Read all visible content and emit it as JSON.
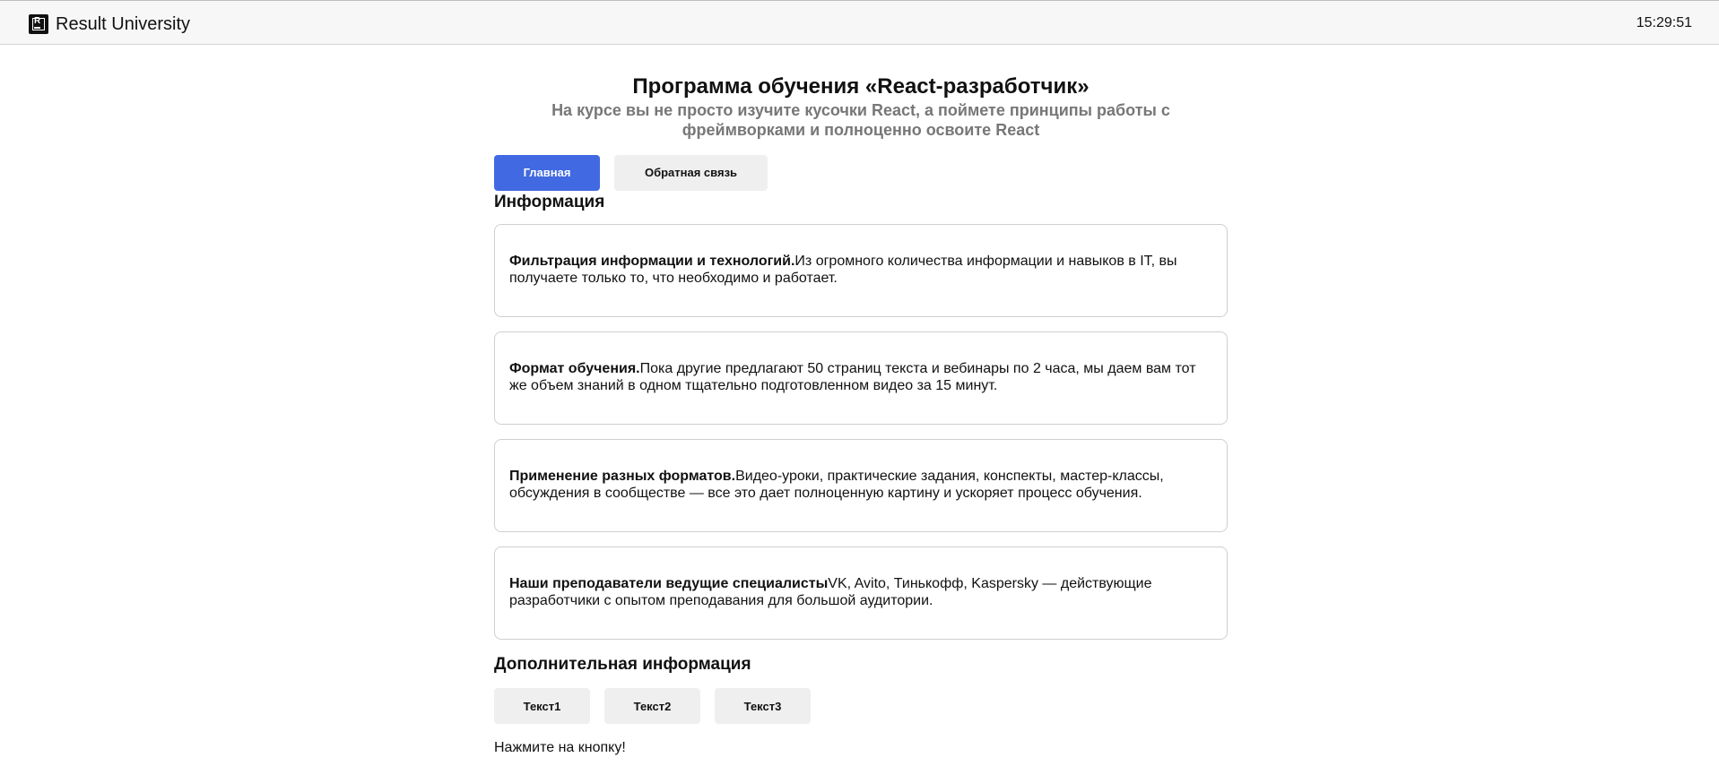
{
  "header": {
    "brand_name": "Result University",
    "logo_icon": "result-university-logo-icon",
    "time": "15:29:51"
  },
  "page": {
    "title": "Программа обучения «React-разработчик»",
    "subtitle": "На курсе вы не просто изучите кусочки React, а поймете принципы работы с фреймворками и полноценно освоите React"
  },
  "navigation": {
    "main_label": "Главная",
    "feedback_label": "Обратная связь"
  },
  "info": {
    "title": "Информация",
    "cards": [
      {
        "title": "Фильтрация информации и технологий.",
        "text": "Из огромного количества информации и навыков в IT, вы получаете только то, что необходимо и работает."
      },
      {
        "title": "Формат обучения.",
        "text": "Пока другие предлагают 50 страниц текста и вебинары по 2 часа, мы даем вам тот же объем знаний в одном тщательно подготовленном видео за 15 минут."
      },
      {
        "title": "Применение разных форматов.",
        "text": "Видео-уроки, практические задания, конспекты, мастер-классы, обсуждения в сообществе — все это дает полноценную картину и ускоряет процесс обучения."
      },
      {
        "title": "Наши преподаватели ведущие специалисты",
        "text": "VK, Avito, Тинькофф, Kaspersky — действующие разработчики с опытом преподавания для большой аудитории."
      }
    ]
  },
  "extra": {
    "title": "Дополнительная информация",
    "buttons": [
      "Текст1",
      "Текст2",
      "Текст3"
    ],
    "hint": "Нажмите на кнопку!"
  },
  "colors": {
    "accent": "#4169E1",
    "top_bar": "#F7F7F7",
    "secondary_button": "#EFEFEF",
    "muted_text": "#777777",
    "card_border": "#CFCFCF"
  }
}
